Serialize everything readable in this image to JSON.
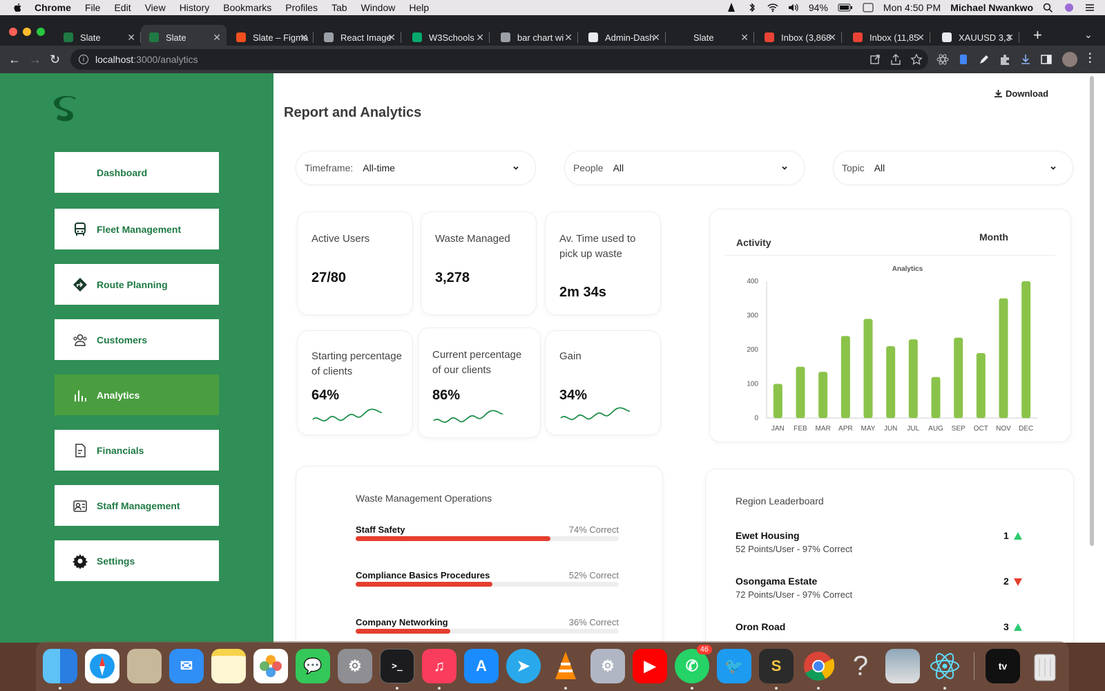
{
  "menubar": {
    "app": "Chrome",
    "items": [
      "File",
      "Edit",
      "View",
      "History",
      "Bookmarks",
      "Profiles",
      "Tab",
      "Window",
      "Help"
    ],
    "battery": "94%",
    "clock": "Mon 4:50 PM",
    "user": "Michael Nwankwo"
  },
  "tabs": [
    {
      "label": "Slate",
      "color": "#1f7a44",
      "active": false
    },
    {
      "label": "Slate",
      "color": "#1f7a44",
      "active": true
    },
    {
      "label": "Slate – Figma",
      "color": "#f24e1e",
      "active": false
    },
    {
      "label": "React Image",
      "color": "#9aa0a6",
      "active": false
    },
    {
      "label": "W3Schools",
      "color": "#04aa6d",
      "active": false
    },
    {
      "label": "bar chart wi",
      "color": "#9aa0a6",
      "active": false
    },
    {
      "label": "Admin-Dash",
      "color": "#e8eaed",
      "active": false
    },
    {
      "label": "Slate",
      "color": "#202124",
      "active": false
    },
    {
      "label": "Inbox (3,868",
      "color": "#ea4335",
      "active": false
    },
    {
      "label": "Inbox (11,85",
      "color": "#ea4335",
      "active": false
    },
    {
      "label": "XAUUSD 3,3",
      "color": "#e8eaed",
      "active": false
    }
  ],
  "address": {
    "host": "localhost",
    "path": ":3000/analytics"
  },
  "sidebar": {
    "items": [
      {
        "label": "Dashboard",
        "icon": "none",
        "active": false
      },
      {
        "label": "Fleet Management",
        "icon": "bus-icon",
        "active": false
      },
      {
        "label": "Route Planning",
        "icon": "route-icon",
        "active": false
      },
      {
        "label": "Customers",
        "icon": "users-icon",
        "active": false
      },
      {
        "label": "Analytics",
        "icon": "bar-chart-icon",
        "active": true
      },
      {
        "label": "Financials",
        "icon": "document-icon",
        "active": false
      },
      {
        "label": "Staff Management",
        "icon": "staff-icon",
        "active": false
      },
      {
        "label": "Settings",
        "icon": "gear-icon",
        "active": false
      }
    ]
  },
  "header": {
    "title": "Report and Analytics",
    "download": "Download"
  },
  "filters": [
    {
      "label": "Timeframe:",
      "value": "All-time"
    },
    {
      "label": "People",
      "value": "All"
    },
    {
      "label": "Topic",
      "value": "All"
    }
  ],
  "stats": {
    "active_users": {
      "label": "Active Users",
      "value": "27/80"
    },
    "waste_managed": {
      "label": "Waste Managed",
      "value": "3,278"
    },
    "avg_time": {
      "label_1": "Av. Time used to",
      "label_2": "pick up waste",
      "value": "2m 34s"
    },
    "starting_pct": {
      "label_1": "Starting percentage",
      "label_2": "of clients",
      "value": "64%"
    },
    "current_pct": {
      "label_1": "Current percentage",
      "label_2": "of our clients",
      "value": "86%"
    },
    "gain": {
      "label": "Gain",
      "value": "34%"
    }
  },
  "activity": {
    "title": "Activity",
    "period": "Month"
  },
  "chart_data": {
    "type": "bar",
    "title": "Analytics",
    "categories": [
      "JAN",
      "FEB",
      "MAR",
      "APR",
      "MAY",
      "JUN",
      "JUL",
      "AUG",
      "SEP",
      "OCT",
      "NOV",
      "DEC"
    ],
    "values": [
      100,
      150,
      135,
      240,
      290,
      210,
      230,
      120,
      235,
      190,
      350,
      400
    ],
    "ylim": [
      0,
      400
    ],
    "yticks": [
      0,
      100,
      200,
      300,
      400
    ],
    "color": "#8bc34a",
    "grid": false
  },
  "waste_ops": {
    "title": "Waste Management Operations",
    "rows": [
      {
        "name": "Staff Safety",
        "pct_label": "74% Correct",
        "pct": 74
      },
      {
        "name": "Compliance Basics Procedures",
        "pct_label": "52% Correct",
        "pct": 52
      },
      {
        "name": "Company Networking",
        "pct_label": "36% Correct",
        "pct": 36
      }
    ]
  },
  "leaderboard": {
    "title": "Region Leaderboard",
    "rows": [
      {
        "name": "Ewet Housing",
        "sub": "52 Points/User - 97% Correct",
        "rank": "1",
        "trend": "up"
      },
      {
        "name": "Osongama Estate",
        "sub": "72 Points/User - 97% Correct",
        "rank": "2",
        "trend": "down"
      },
      {
        "name": "Oron Road",
        "sub": "",
        "rank": "3",
        "trend": "up"
      }
    ]
  },
  "dock": {
    "whatsapp_badge": "46"
  }
}
